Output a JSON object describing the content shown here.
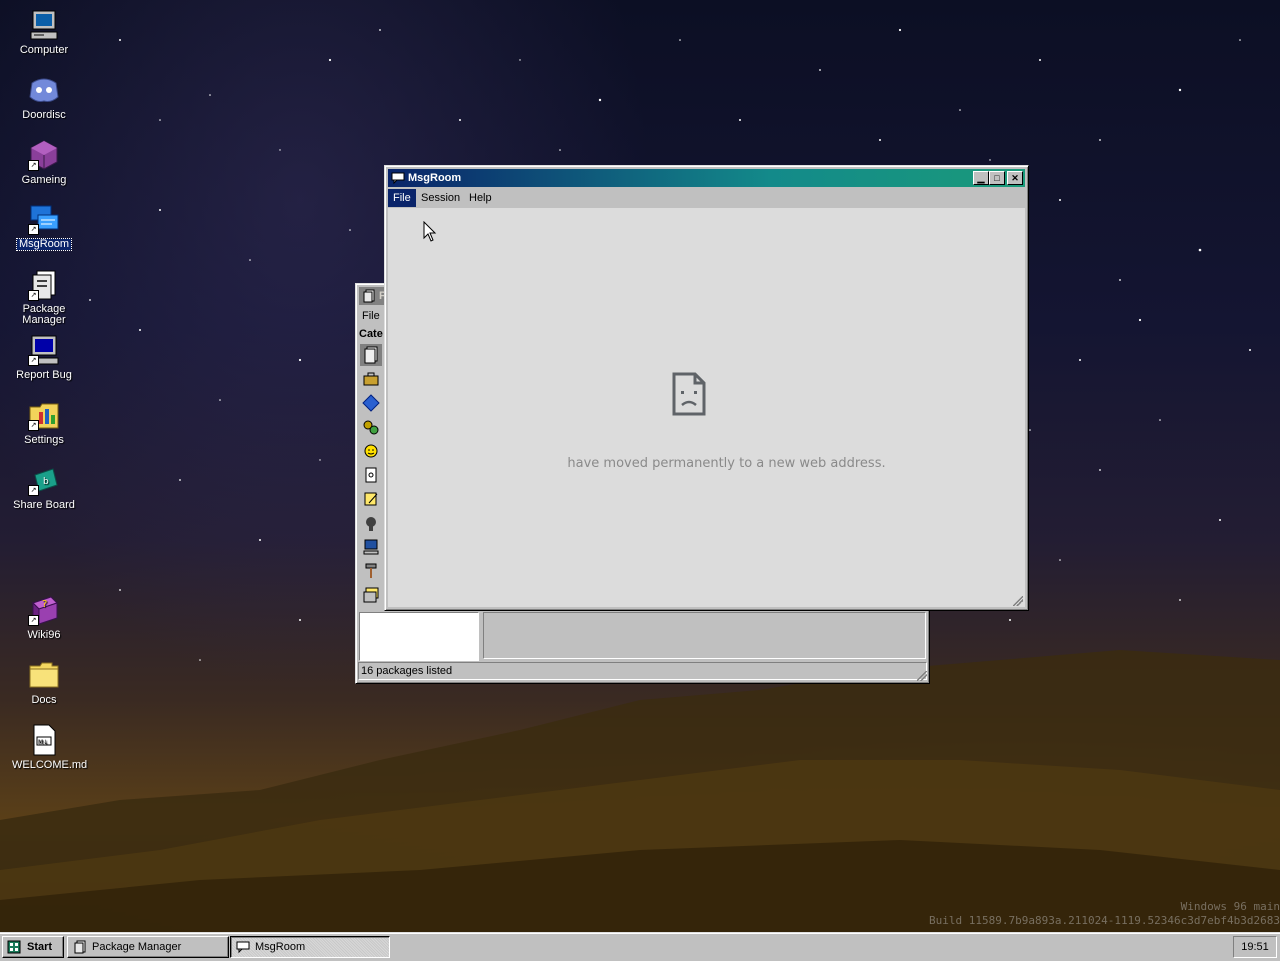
{
  "desktop_icons": [
    {
      "label": "Computer",
      "icon": "computer-icon"
    },
    {
      "label": "Doordisc",
      "icon": "discord-icon"
    },
    {
      "label": "Gameing",
      "icon": "game-cube-icon"
    },
    {
      "label": "MsgRoom",
      "icon": "msgroom-icon"
    },
    {
      "label": "Package Manager",
      "icon": "package-manager-icon"
    },
    {
      "label": "Report Bug",
      "icon": "report-bug-icon"
    },
    {
      "label": "Settings",
      "icon": "settings-icon"
    },
    {
      "label": "Share Board",
      "icon": "share-board-icon"
    },
    {
      "label": "Wiki96",
      "icon": "wiki-book-icon"
    },
    {
      "label": "Docs",
      "icon": "folder-icon"
    },
    {
      "label": "WELCOME.md",
      "icon": "markdown-file-icon"
    }
  ],
  "msgroom": {
    "title": "MsgRoom",
    "menu": [
      "File",
      "Session",
      "Help"
    ],
    "error_message": "have moved permanently to a new web address."
  },
  "package_manager": {
    "title": "P",
    "menu_file": "File",
    "category_label": "Cate",
    "status": "16 packages listed"
  },
  "taskbar": {
    "start": "Start",
    "buttons": [
      "Package Manager",
      "MsgRoom"
    ],
    "clock": "19:51"
  },
  "watermark": {
    "line1": "Windows 96 main",
    "line2": "Build 11589.7b9a893a.211024-1119.52346c3d7ebf4b3d2683"
  },
  "colors": {
    "title_active": "#0a246a",
    "title_active_end": "#1a9a7a",
    "window_face": "#c0c0c0",
    "selection": "#0a246a"
  }
}
